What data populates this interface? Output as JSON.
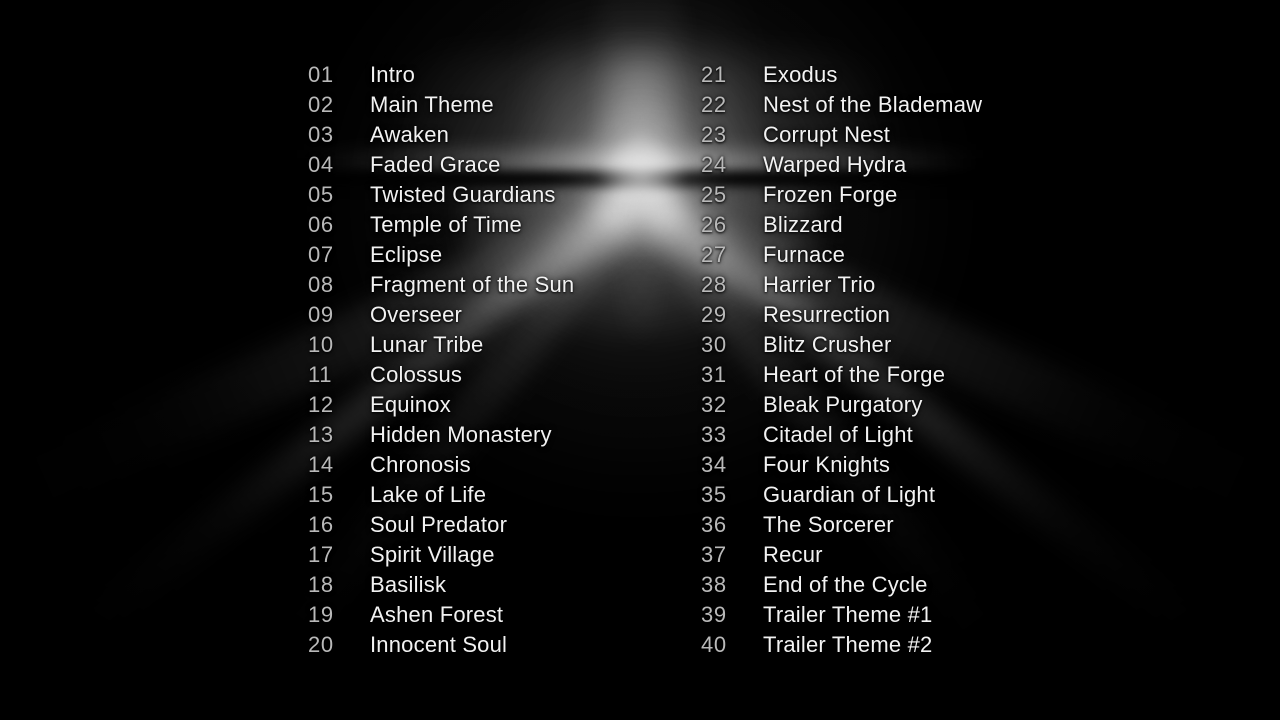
{
  "screen": {
    "kind": "soundtrack-track-listing",
    "background_color": "#000000",
    "number_color": "#b9b9b9",
    "title_color": "#f2f2f2",
    "accent_color": "#ffffff"
  },
  "background": {
    "motif": "diamond-light-burst",
    "elements": [
      "halo-glow",
      "vertical-beam",
      "horizontal-flare",
      "dark-horizon-band",
      "diamond-core",
      "diagonal-light-rays"
    ]
  },
  "columns": [
    {
      "name": "left-column",
      "tracks": [
        {
          "number": "01",
          "title": "Intro"
        },
        {
          "number": "02",
          "title": "Main Theme"
        },
        {
          "number": "03",
          "title": "Awaken"
        },
        {
          "number": "04",
          "title": "Faded Grace"
        },
        {
          "number": "05",
          "title": "Twisted Guardians"
        },
        {
          "number": "06",
          "title": "Temple of Time"
        },
        {
          "number": "07",
          "title": "Eclipse"
        },
        {
          "number": "08",
          "title": "Fragment of the Sun"
        },
        {
          "number": "09",
          "title": "Overseer"
        },
        {
          "number": "10",
          "title": "Lunar Tribe"
        },
        {
          "number": "11",
          "title": "Colossus"
        },
        {
          "number": "12",
          "title": "Equinox"
        },
        {
          "number": "13",
          "title": "Hidden Monastery"
        },
        {
          "number": "14",
          "title": "Chronosis"
        },
        {
          "number": "15",
          "title": "Lake of Life"
        },
        {
          "number": "16",
          "title": "Soul Predator"
        },
        {
          "number": "17",
          "title": "Spirit Village"
        },
        {
          "number": "18",
          "title": "Basilisk"
        },
        {
          "number": "19",
          "title": "Ashen Forest"
        },
        {
          "number": "20",
          "title": "Innocent Soul"
        }
      ]
    },
    {
      "name": "right-column",
      "tracks": [
        {
          "number": "21",
          "title": "Exodus"
        },
        {
          "number": "22",
          "title": "Nest of the Blademaw"
        },
        {
          "number": "23",
          "title": "Corrupt Nest"
        },
        {
          "number": "24",
          "title": "Warped Hydra"
        },
        {
          "number": "25",
          "title": "Frozen Forge"
        },
        {
          "number": "26",
          "title": "Blizzard"
        },
        {
          "number": "27",
          "title": "Furnace"
        },
        {
          "number": "28",
          "title": "Harrier Trio"
        },
        {
          "number": "29",
          "title": "Resurrection"
        },
        {
          "number": "30",
          "title": "Blitz Crusher"
        },
        {
          "number": "31",
          "title": "Heart of the Forge"
        },
        {
          "number": "32",
          "title": "Bleak Purgatory"
        },
        {
          "number": "33",
          "title": "Citadel of Light"
        },
        {
          "number": "34",
          "title": "Four Knights"
        },
        {
          "number": "35",
          "title": "Guardian of Light"
        },
        {
          "number": "36",
          "title": "The Sorcerer"
        },
        {
          "number": "37",
          "title": "Recur"
        },
        {
          "number": "38",
          "title": "End of the Cycle"
        },
        {
          "number": "39",
          "title": "Trailer Theme #1"
        },
        {
          "number": "40",
          "title": "Trailer Theme #2"
        }
      ]
    }
  ]
}
